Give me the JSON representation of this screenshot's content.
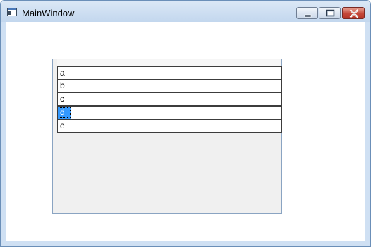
{
  "window": {
    "title": "MainWindow"
  },
  "list": {
    "rows": [
      {
        "label": "a",
        "selected": false
      },
      {
        "label": "b",
        "selected": false
      },
      {
        "label": "c",
        "selected": false
      },
      {
        "label": "d",
        "selected": true
      },
      {
        "label": "e",
        "selected": false
      }
    ]
  },
  "colors": {
    "selection": "#3399ff",
    "titlebar": "#c3d7ee",
    "close": "#c4483a"
  }
}
